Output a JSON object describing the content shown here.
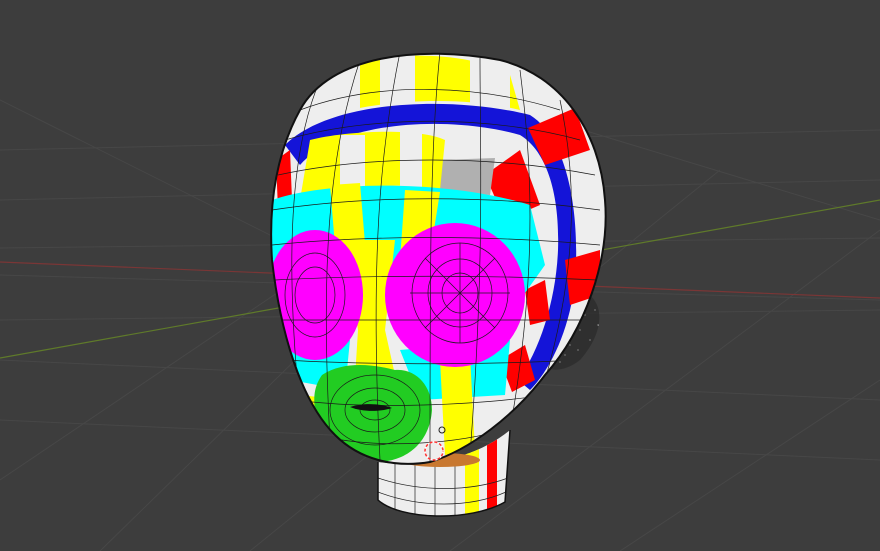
{
  "viewport": {
    "background": "#3d3d3d",
    "grid_color": "#4a4a4a",
    "x_axis_color": "#8a3a3a",
    "y_axis_color": "#6a8a2a"
  },
  "model": {
    "name": "",
    "mode": "edit-mesh-face-sets",
    "region_colors": {
      "crown_stripe": "#1414d8",
      "upper_band": "#ffff00",
      "forehead": "#00ffff",
      "eye_sockets": "#ff00ff",
      "mouth_area": "#22cc22",
      "side_bands": "#ff0000",
      "base_white": "#eeeeee",
      "selected_face": "#b0b0b0"
    }
  },
  "icons": {
    "cursor": "3d-cursor-icon"
  }
}
